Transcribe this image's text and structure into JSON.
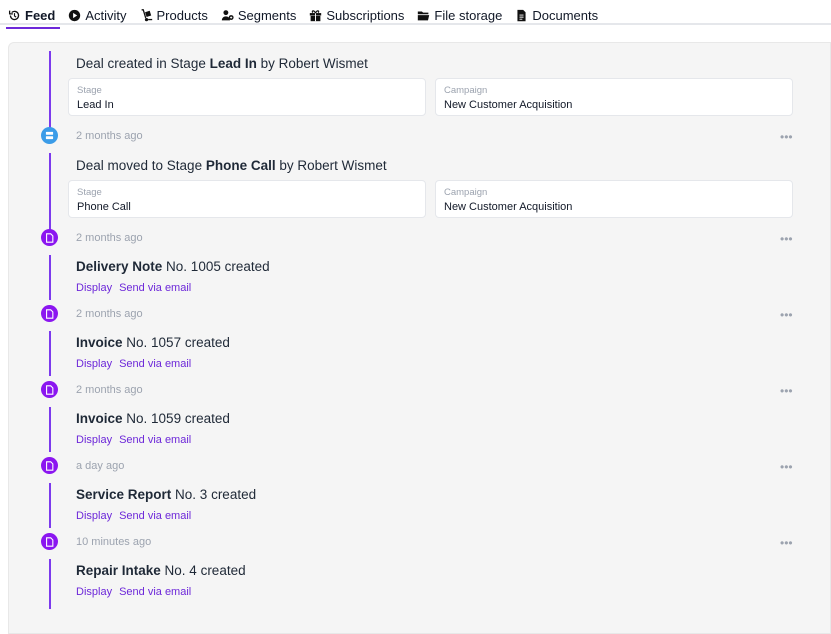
{
  "tabs": [
    {
      "label": "Feed",
      "icon": "history-icon",
      "active": true
    },
    {
      "label": "Activity",
      "icon": "play-circle-icon"
    },
    {
      "label": "Products",
      "icon": "hand-truck-icon"
    },
    {
      "label": "Segments",
      "icon": "user-group-icon"
    },
    {
      "label": "Subscriptions",
      "icon": "gift-icon"
    },
    {
      "label": "File storage",
      "icon": "folder-icon"
    },
    {
      "label": "Documents",
      "icon": "document-icon"
    }
  ],
  "feed": {
    "deal_created": {
      "prefix": "Deal created in Stage ",
      "stage": "Lead In",
      "suffix": " by Robert Wismet",
      "stage_label": "Stage",
      "stage_value": "Lead In",
      "campaign_label": "Campaign",
      "campaign_value": "New Customer Acquisition"
    },
    "deal_moved": {
      "time": "2 months ago",
      "prefix": "Deal moved to Stage ",
      "stage": "Phone Call",
      "suffix": " by Robert Wismet",
      "stage_label": "Stage",
      "stage_value": "Phone Call",
      "campaign_label": "Campaign",
      "campaign_value": "New Customer Acquisition"
    },
    "documents": [
      {
        "time": "2 months ago",
        "name": "Delivery Note",
        "rest": " No. 1005 created"
      },
      {
        "time": "2 months ago",
        "name": "Invoice",
        "rest": " No. 1057 created"
      },
      {
        "time": "2 months ago",
        "name": "Invoice",
        "rest": " No. 1059 created"
      },
      {
        "time": "a day ago",
        "name": "Service Report",
        "rest": " No. 3 created"
      },
      {
        "time": "10 minutes ago",
        "name": "Repair Intake",
        "rest": " No. 4 created"
      }
    ],
    "display_label": "Display",
    "email_label": "Send via email",
    "more_label": "•••"
  },
  "colors": {
    "accent": "#6d28d9",
    "dot_purple": "#8b16f0",
    "dot_blue": "#3b9ce8",
    "panel": "#f5f5f5"
  }
}
